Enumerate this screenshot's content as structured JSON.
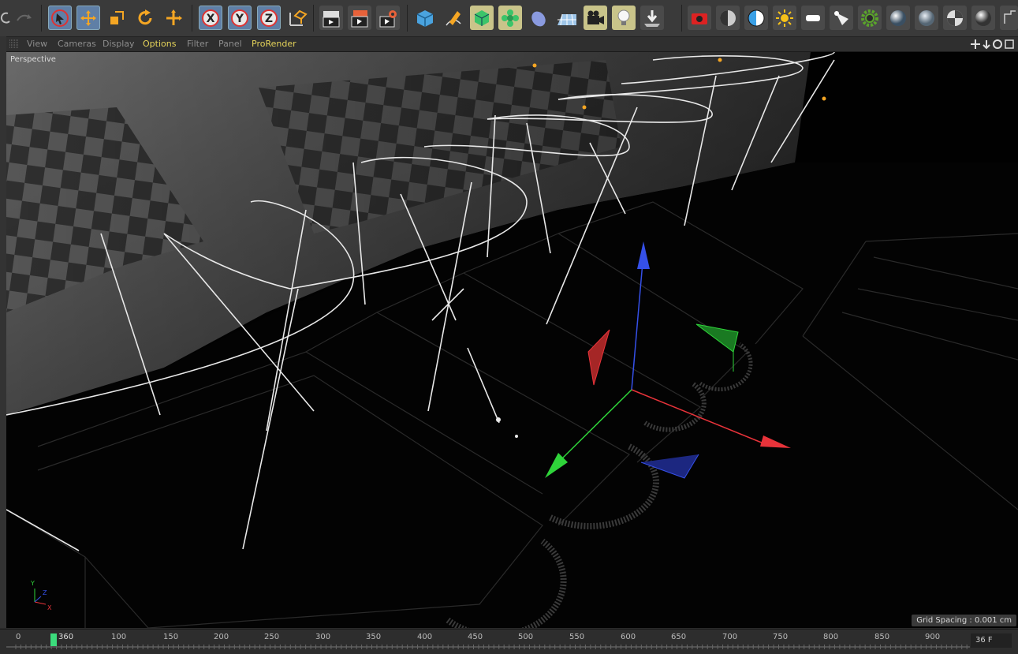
{
  "toolbar": {
    "icons": [
      "undo-icon",
      "redo-icon",
      "live-select-icon",
      "move-icon",
      "scale-icon",
      "rotate-icon",
      "recent-tool-icon",
      "x-axis-lock-icon",
      "y-axis-lock-icon",
      "z-axis-lock-icon",
      "coordinate-system-icon",
      "render-view-icon",
      "render-picture-viewer-icon",
      "edit-render-settings-icon",
      "cube-icon",
      "pen-spline-icon",
      "subdivision-surface-icon",
      "cloner-icon",
      "deformer-icon",
      "floor-icon",
      "camera-icon",
      "light-icon",
      "drop-to-floor-icon",
      "prorender-camera-icon",
      "halfsphere-icon",
      "contrast-icon",
      "sun-icon",
      "area-light-icon",
      "spot-light-icon",
      "gear-render-icon",
      "material-sphere-icon",
      "glass-sphere-icon",
      "checker-sphere-icon",
      "chrome-sphere-icon",
      "more-icon"
    ],
    "axis_labels": [
      "X",
      "Y",
      "Z"
    ]
  },
  "menubar": {
    "items": [
      "View",
      "Cameras",
      "Display",
      "Options",
      "Filter",
      "Panel",
      "ProRender"
    ],
    "active_items": [
      "Options",
      "ProRender"
    ]
  },
  "viewport": {
    "label": "Perspective",
    "grid_spacing": "Grid Spacing : 0.001 cm",
    "axis_colors": {
      "x": "#e8333a",
      "y": "#2fd43a",
      "z": "#3550e8"
    }
  },
  "timeline": {
    "ticks": [
      "0",
      "50",
      "100",
      "150",
      "200",
      "250",
      "300",
      "350",
      "400",
      "450",
      "500",
      "550",
      "600",
      "650",
      "700",
      "750",
      "800",
      "850",
      "900"
    ],
    "playhead_label": "360",
    "current_frame": "36 F"
  }
}
